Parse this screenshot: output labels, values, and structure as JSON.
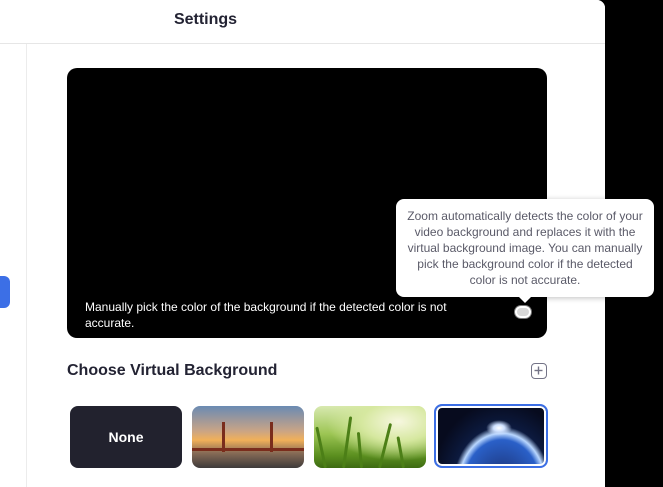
{
  "window": {
    "title": "Settings"
  },
  "preview": {
    "caption": "Manually pick the color of the background if the detected color is not accurate.",
    "tooltip": "Zoom automatically detects the color of your video background and replaces it with the virtual background image. You can manually pick the background color if the detected color is not accurate.",
    "swatch_color": "#d8d8d8"
  },
  "virtual_background": {
    "heading": "Choose Virtual Background",
    "add_icon": "plus-icon",
    "items": [
      {
        "label": "None",
        "selected": false
      },
      {
        "label": "",
        "scene": "golden-gate-bridge",
        "selected": false
      },
      {
        "label": "",
        "scene": "grass",
        "selected": false
      },
      {
        "label": "",
        "scene": "earth-from-space",
        "selected": true
      }
    ]
  },
  "colors": {
    "accent": "#3c6fe6",
    "text_primary": "#232333"
  }
}
